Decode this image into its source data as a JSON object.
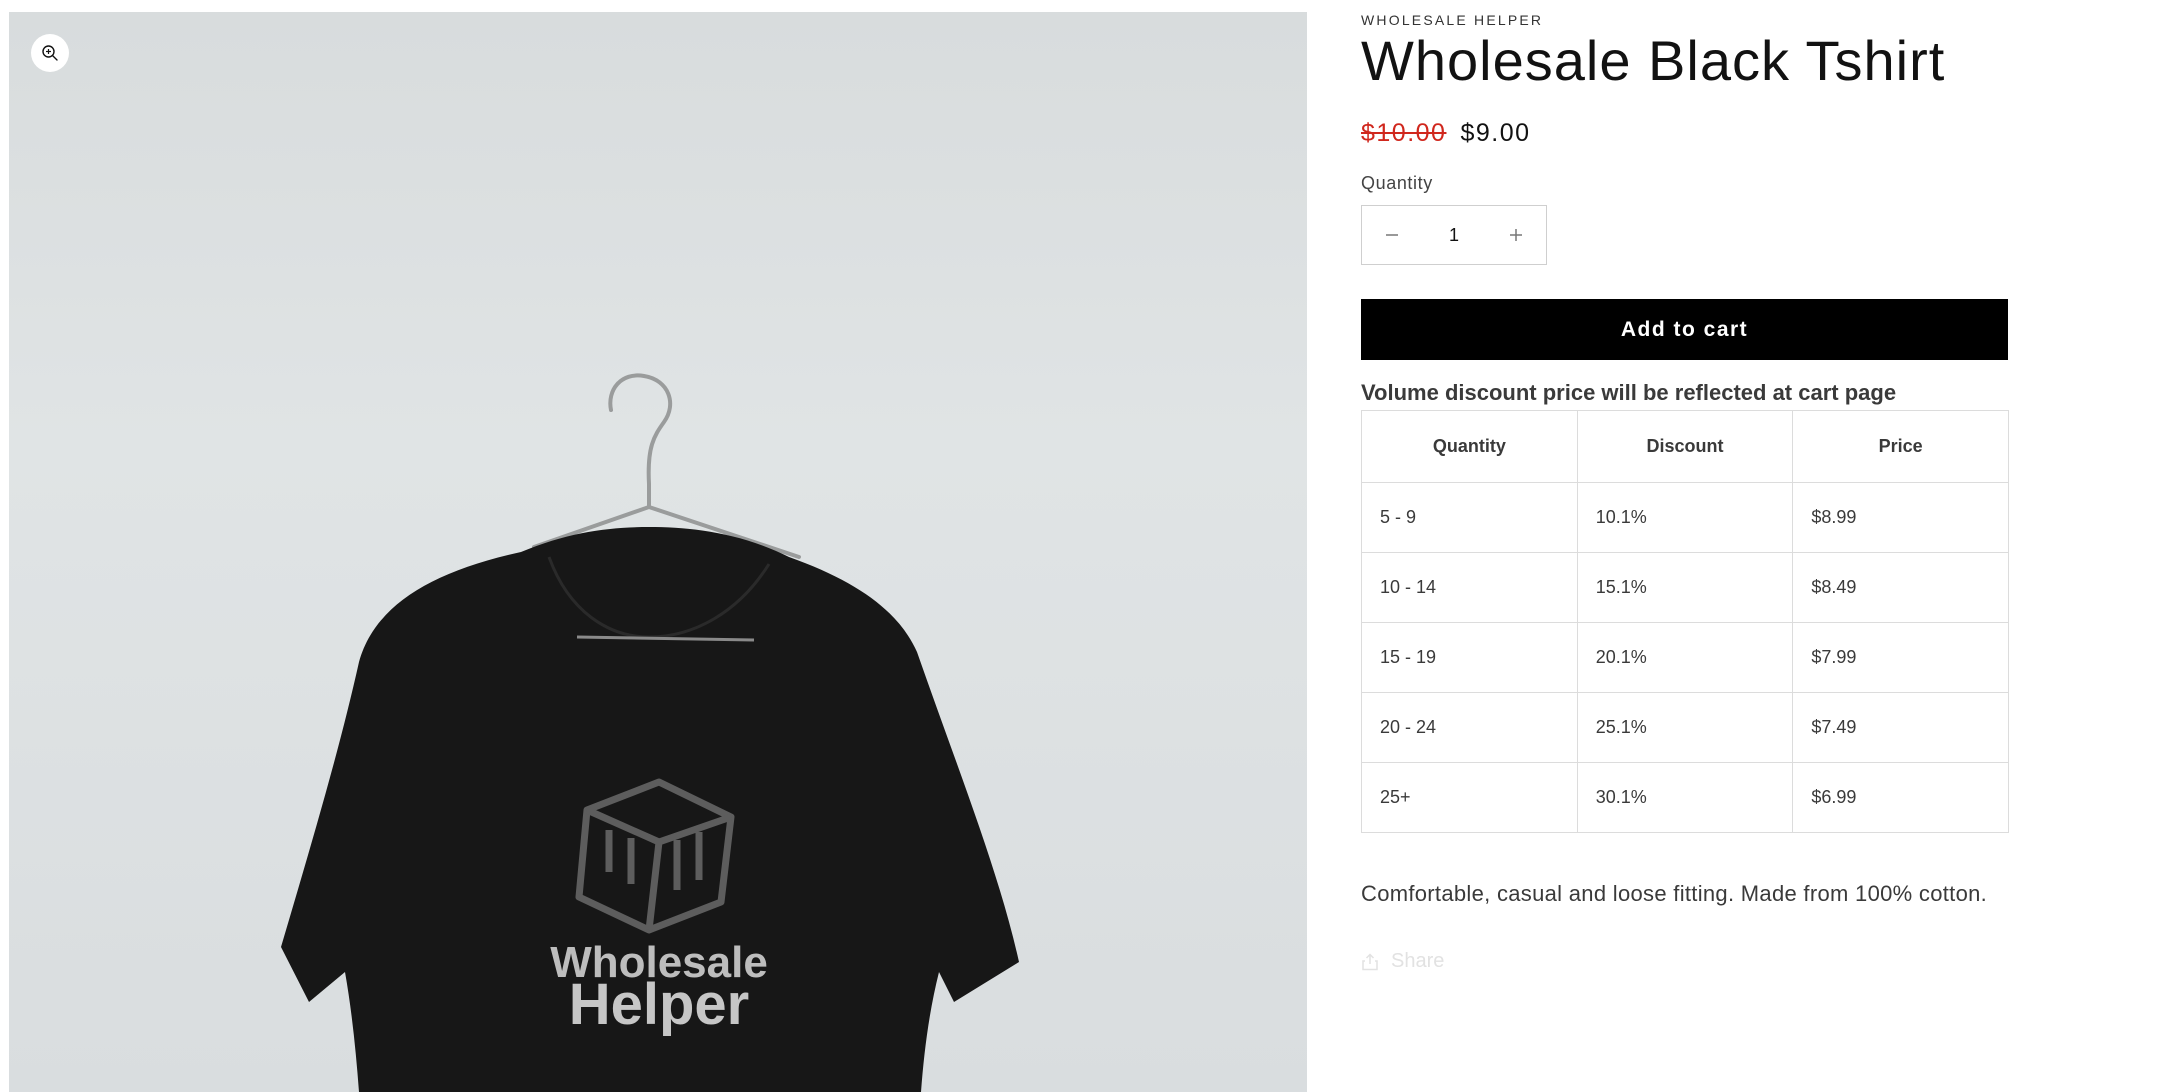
{
  "product": {
    "vendor": "WHOLESALE HELPER",
    "title": "Wholesale Black Tshirt",
    "compare_price": "$10.00",
    "price": "$9.00",
    "description": "Comfortable, casual and loose fitting. Made from 100% cotton."
  },
  "media": {
    "print_line_1": "Wholesale",
    "print_line_2": "Helper",
    "zoom_icon": "zoom-in-icon"
  },
  "quantity": {
    "label": "Quantity",
    "value": "1",
    "minus_icon": "minus-icon",
    "plus_icon": "plus-icon"
  },
  "cart": {
    "add_label": "Add to cart"
  },
  "volume_discount": {
    "note": "Volume discount price will be reflected at cart page",
    "headers": [
      "Quantity",
      "Discount",
      "Price"
    ],
    "rows": [
      [
        "5 - 9",
        "10.1%",
        "$8.99"
      ],
      [
        "10 - 14",
        "15.1%",
        "$8.49"
      ],
      [
        "15 - 19",
        "20.1%",
        "$7.99"
      ],
      [
        "20 - 24",
        "25.1%",
        "$7.49"
      ],
      [
        "25+",
        "30.1%",
        "$6.99"
      ]
    ]
  },
  "share": {
    "label": "Share",
    "icon": "share-icon"
  },
  "colors": {
    "sale_price": "#d0271d",
    "button_bg": "#000000",
    "button_text": "#ffffff",
    "table_border": "#dcdcdc",
    "share_text": "#e2e2e2"
  }
}
